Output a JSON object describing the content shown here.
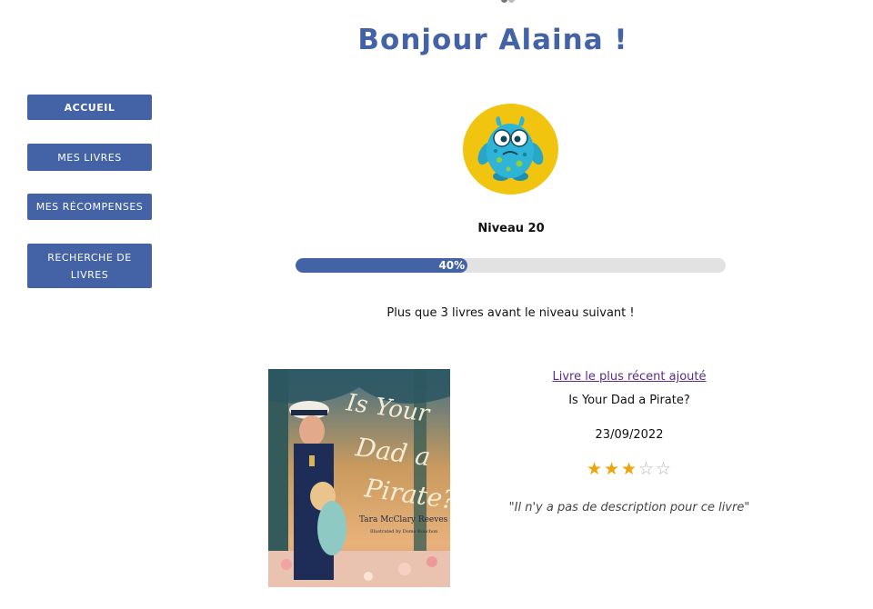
{
  "header": {
    "greeting": "Bonjour Alaina !"
  },
  "sidebar": {
    "items": [
      {
        "label": "ACCUEIL",
        "active": true
      },
      {
        "label": "MES LIVRES",
        "active": false
      },
      {
        "label": "MES RÉCOMPENSES",
        "active": false
      },
      {
        "label": "RECHERCHE DE LIVRES",
        "active": false
      }
    ]
  },
  "profile": {
    "avatar_icon": "blue-monster-icon",
    "avatar_bg_color": "#f1c40f",
    "level_label": "Niveau 20",
    "progress_percent": 40,
    "progress_text": "40%",
    "next_level_text": "Plus que 3 livres avant le niveau suivant !"
  },
  "recent_book": {
    "section_link": "Livre le plus récent ajouté",
    "title": "Is Your Dad a Pirate?",
    "date": "23/09/2022",
    "rating": 3,
    "rating_max": 5,
    "description": "\"Il n'y a pas de description pour ce livre\"",
    "cover": {
      "title_text": "Is Your Dad a Pirate?",
      "author": "Tara McClary Reeves",
      "illustrator": "Illustrated by Dome Bouchon"
    }
  },
  "colors": {
    "brand": "#4462a6",
    "star": "#f0a30a",
    "link": "#5a2d8a"
  }
}
